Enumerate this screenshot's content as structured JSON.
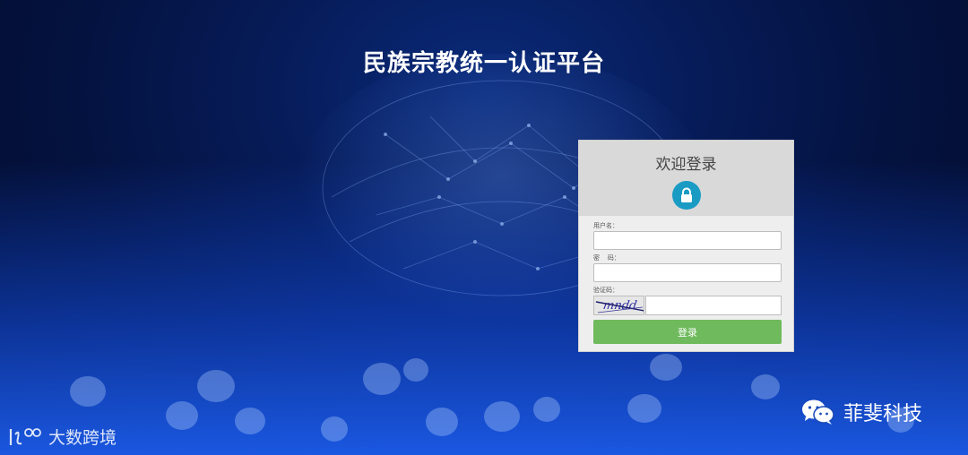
{
  "page": {
    "title": "民族宗教统一认证平台"
  },
  "login": {
    "header": "欢迎登录",
    "lock_icon": "lock-icon",
    "username_label": "用户名：",
    "username_value": "",
    "password_label": "密    码：",
    "password_value": "",
    "captcha_label": "验证码：",
    "captcha_image_text": "mndd",
    "captcha_value": "",
    "submit_label": "登录"
  },
  "watermarks": {
    "right_text": "菲斐科技",
    "right_icon": "wechat-icon",
    "left_text": "大数跨境",
    "left_icon": "dashu-logo-icon"
  },
  "colors": {
    "accent_blue": "#1a9bc4",
    "button_green": "#6fba5d",
    "card_bg": "#eeeeee",
    "card_head_bg": "#d9d9d9"
  }
}
